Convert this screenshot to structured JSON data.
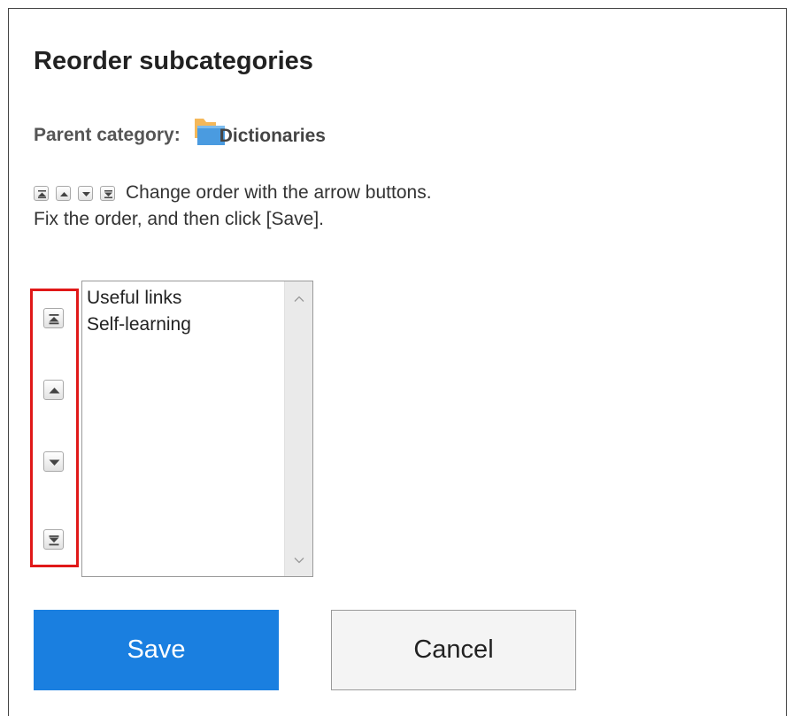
{
  "dialog": {
    "title": "Reorder subcategories",
    "parent_label": "Parent category:",
    "parent_name": "Dictionaries",
    "parent_icon": "folder-icon",
    "instructions_line1": "Change order with the arrow buttons.",
    "instructions_line2": "Fix the order, and then click [Save]."
  },
  "reorder_controls": [
    {
      "name": "move-to-top",
      "icon": "double-up-arrow-icon"
    },
    {
      "name": "move-up",
      "icon": "up-arrow-icon"
    },
    {
      "name": "move-down",
      "icon": "down-arrow-icon"
    },
    {
      "name": "move-to-bottom",
      "icon": "double-down-arrow-icon"
    }
  ],
  "subcategories": {
    "items": [
      "Useful links",
      "Self-learning"
    ]
  },
  "buttons": {
    "save_label": "Save",
    "cancel_label": "Cancel"
  },
  "colors": {
    "primary": "#1a7fe0",
    "highlight": "#e01818",
    "folder": "#f5b041",
    "folder_front": "#4a9be0"
  }
}
